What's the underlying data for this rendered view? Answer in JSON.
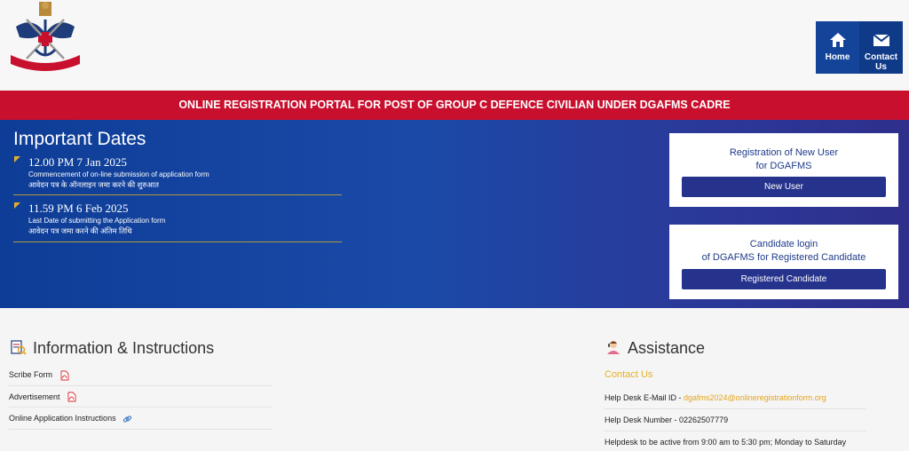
{
  "header": {
    "logo_alt": "Armed Forces Medical Services",
    "nav": [
      {
        "label": "Home",
        "icon": "home-icon"
      },
      {
        "label": "Contact Us",
        "icon": "envelope-icon"
      }
    ]
  },
  "banner": {
    "text": "ONLINE REGISTRATION PORTAL FOR POST OF GROUP C DEFENCE CIVILIAN UNDER DGAFMS CADRE"
  },
  "important_dates": {
    "title": "Important Dates",
    "items": [
      {
        "date": "12.00 PM 7 Jan 2025",
        "en": "Commencement of on-line submission of application form",
        "hi": "आवेदन पत्र के ऑनलाइन जमा करने की शुरुआत"
      },
      {
        "date": "11.59 PM 6 Feb 2025",
        "en": "Last Date of submitting the Application form",
        "hi": "आवेदन पत्र जमा करने की अंतिम तिथि"
      }
    ]
  },
  "cards": [
    {
      "line1": "Registration of New User",
      "line2": "for DGAFMS",
      "button": "New User"
    },
    {
      "line1": "Candidate login",
      "line2": "of DGAFMS for Registered Candidate",
      "button": "Registered Candidate"
    }
  ],
  "info": {
    "title": "Information & Instructions",
    "items": [
      {
        "label": "Scribe Form",
        "icon": "pdf-icon"
      },
      {
        "label": "Advertisement",
        "icon": "pdf-icon"
      },
      {
        "label": "Online Application Instructions",
        "icon": "link-icon"
      }
    ]
  },
  "assistance": {
    "title": "Assistance",
    "subtitle": "Contact Us",
    "email_label": "Help Desk E-Mail ID - ",
    "email": "dgafms2024@onlineregistrationform.org",
    "phone": "Help Desk Number - 02262507779",
    "hours": "Helpdesk to be active from 9:00 am to 5:30 pm; Monday to Saturday"
  },
  "colors": {
    "primary": "#13449a",
    "banner": "#c8102e",
    "accent": "#e3b028",
    "button": "#26338c"
  }
}
